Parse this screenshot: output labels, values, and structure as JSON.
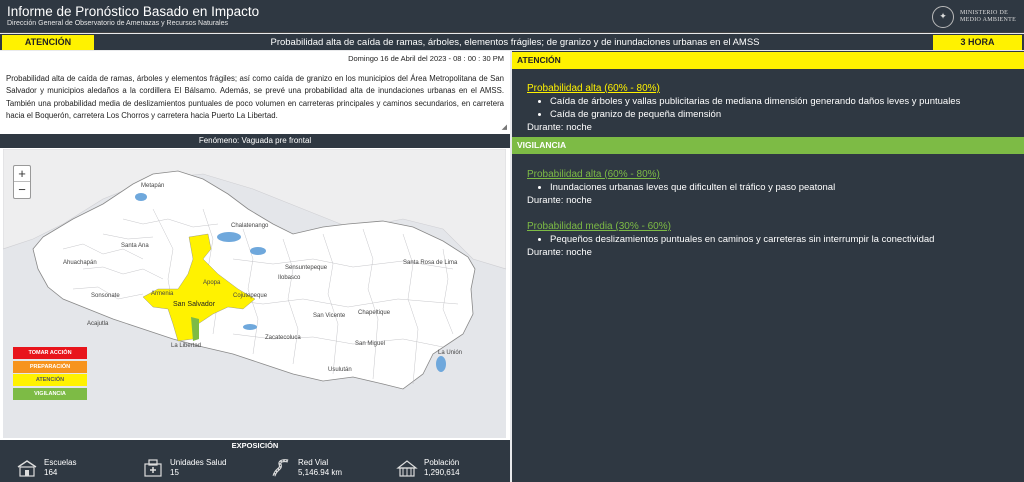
{
  "header": {
    "title": "Informe de Pronóstico Basado en Impacto",
    "subtitle": "Dirección General de Observatorio de Amenazas y Recursos Naturales",
    "ministry_line1": "MINISTERIO DE",
    "ministry_line2": "MEDIO AMBIENTE"
  },
  "alert_bar": {
    "level": "ATENCIÓN",
    "message": "Probabilidad alta de caída de ramas, árboles, elementos frágiles; de granizo y de inundaciones urbanas en el AMSS",
    "duration": "3 HORA"
  },
  "report": {
    "datetime": "Domingo 16 de Abril del 2023 - 08 : 00 : 30 PM",
    "description": "Probabilidad alta de caída de ramas, árboles y elementos frágiles; así como caída de granizo en los municipios del Área Metropolitana de San Salvador y municipios aledaños a la cordillera El Bálsamo. Además, se prevé una probabilidad alta de inundaciones urbanas en el AMSS. También una probabilidad media de deslizamientos puntuales de poco volumen en carreteras principales y caminos secundarios, en carretera hacia el Boquerón, carretera Los Chorros y carretera hacia Puerto La Libertad."
  },
  "map": {
    "phenomenon": "Fenómeno: Vaguada pre frontal",
    "zoom_in": "+",
    "zoom_out": "−",
    "places": [
      "Metapán",
      "Chalatenango",
      "Santa Ana",
      "Ahuachapán",
      "Sonsonate",
      "Acajutla",
      "Armenia",
      "Apopa",
      "San Salvador",
      "Cojutepeque",
      "Ilobasco",
      "Sensuntepeque",
      "San Vicente",
      "Zacatecoluca",
      "La Libertad",
      "Usulután",
      "San Miguel",
      "Chapeltique",
      "Santa Rosa de Lima",
      "La Unión"
    ],
    "legend": [
      {
        "label": "TOMAR ACCIÓN",
        "color": "#e8141b"
      },
      {
        "label": "PREPARACIÓN",
        "color": "#f7941d"
      },
      {
        "label": "ATENCIÓN",
        "color": "#fff200"
      },
      {
        "label": "VIGILANCIA",
        "color": "#7dbb45"
      }
    ]
  },
  "exposure": {
    "title": "EXPOSICIÓN",
    "items": [
      {
        "label": "Escuelas",
        "value": "164",
        "icon": "school-icon"
      },
      {
        "label": "Unidades Salud",
        "value": "15",
        "icon": "hospital-icon"
      },
      {
        "label": "Red Vial",
        "value": "5,146.94 km",
        "icon": "road-icon"
      },
      {
        "label": "Población",
        "value": "1,290,614",
        "icon": "population-icon"
      }
    ]
  },
  "warnings": {
    "atencion": {
      "header": "ATENCIÓN",
      "probability": "Probabilidad alta (60% - 80%)",
      "bullets": [
        "Caída de árboles y vallas publicitarias de mediana dimensión generando daños leves y puntuales",
        "Caída de granizo de pequeña dimensión"
      ],
      "duration": "Durante: noche"
    },
    "vigilancia": {
      "header": "VIGILANCIA",
      "alta": {
        "probability": "Probabilidad alta (60% - 80%)",
        "bullets": [
          "Inundaciones urbanas leves que dificulten el tráfico y paso peatonal"
        ],
        "duration": "Durante: noche"
      },
      "media": {
        "probability": "Probabilidad media (30% - 60%)",
        "bullets": [
          "Pequeños deslizamientos puntuales en caminos y carreteras sin interrumpir la conectividad"
        ],
        "duration": "Durante: noche"
      }
    }
  },
  "colors": {
    "panel_dark": "#2f3842",
    "atencion_yellow": "#fff200",
    "vigilancia_green": "#7dbb45"
  }
}
